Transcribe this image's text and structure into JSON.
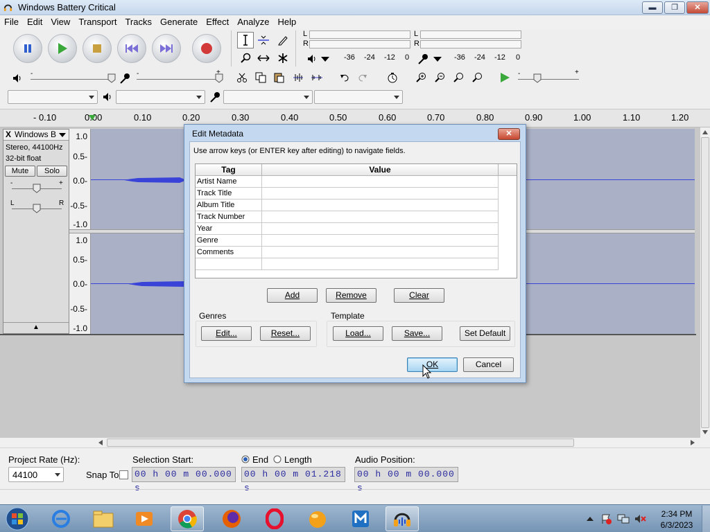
{
  "window": {
    "title": "Windows Battery Critical",
    "min_label": "▬",
    "max_label": "❐",
    "close_label": "✕"
  },
  "menu": [
    "File",
    "Edit",
    "View",
    "Transport",
    "Tracks",
    "Generate",
    "Effect",
    "Analyze",
    "Help"
  ],
  "meters": {
    "playback_L": "L",
    "playback_R": "R",
    "record_L": "L",
    "record_R": "R",
    "playback_ticks": [
      "-36",
      "-24",
      "-12",
      "0"
    ],
    "record_ticks": [
      "-36",
      "-24",
      "-12",
      "0"
    ]
  },
  "slider_marks": {
    "minus": "-",
    "plus": "+"
  },
  "ruler": [
    "- 0.10",
    "0.00",
    "0.10",
    "0.20",
    "0.30",
    "0.40",
    "0.50",
    "0.60",
    "0.70",
    "0.80",
    "0.90",
    "1.00",
    "1.10",
    "1.20"
  ],
  "track": {
    "name": "Windows B",
    "info1": "Stereo, 44100Hz",
    "info2": "32-bit float",
    "mute": "Mute",
    "solo": "Solo",
    "gain_minus": "-",
    "gain_plus": "+",
    "pan_L": "L",
    "pan_R": "R",
    "close_label": "X",
    "collapse_label": "▲"
  },
  "amp_ticks": [
    "1.0",
    "0.5-",
    "0.0-",
    "-0.5-",
    "-1.0"
  ],
  "dialog": {
    "title": "Edit Metadata",
    "close_label": "✕",
    "hint": "Use arrow keys (or ENTER key after editing) to navigate fields.",
    "columns": [
      "Tag",
      "Value"
    ],
    "rows": [
      {
        "tag": "Artist Name",
        "value": ""
      },
      {
        "tag": "Track Title",
        "value": ""
      },
      {
        "tag": "Album Title",
        "value": ""
      },
      {
        "tag": "Track Number",
        "value": ""
      },
      {
        "tag": "Year",
        "value": ""
      },
      {
        "tag": "Genre",
        "value": ""
      },
      {
        "tag": "Comments",
        "value": ""
      },
      {
        "tag": "",
        "value": ""
      }
    ],
    "add": "Add",
    "remove": "Remove",
    "clear": "Clear",
    "genres_label": "Genres",
    "genres_edit": "Edit...",
    "genres_reset": "Reset...",
    "template_label": "Template",
    "template_load": "Load...",
    "template_save": "Save...",
    "template_default": "Set Default",
    "ok": "OK",
    "cancel": "Cancel"
  },
  "status": {
    "project_rate_label": "Project Rate (Hz):",
    "project_rate_value": "44100",
    "snap_to_label": "Snap To",
    "selection_start_label": "Selection Start:",
    "end_label": "End",
    "length_label": "Length",
    "audio_position_label": "Audio Position:",
    "selection_start_value": "00 h 00 m 00.000 s",
    "end_value": "00 h 00 m 01.218 s",
    "audio_position_value": "00 h 00 m 00.000 s"
  },
  "taskbar": {
    "time": "2:34 PM",
    "date": "6/3/2023"
  },
  "colors": {
    "wave": "#3a43d8",
    "track_bg": "#aab1c7",
    "record_button": "#d23a3a",
    "play_green": "#3aa83a"
  }
}
